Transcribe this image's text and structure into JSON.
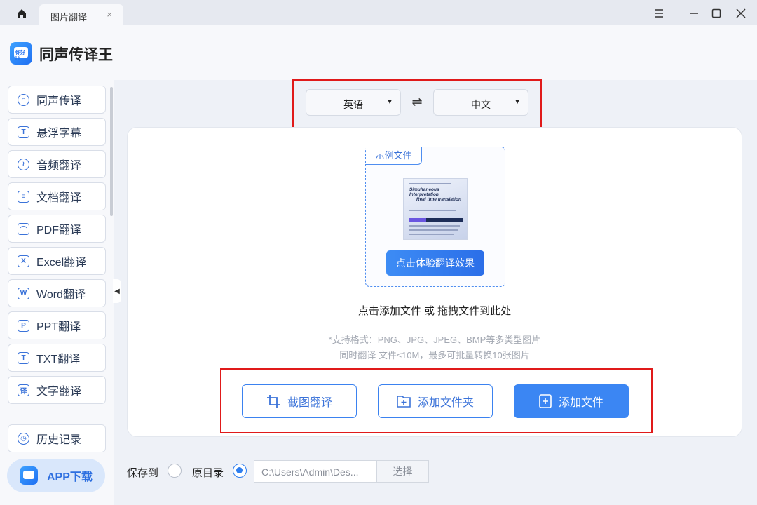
{
  "tab": {
    "label": "图片翻译",
    "close": "×"
  },
  "app": {
    "title": "同声传译王",
    "logo_text": "你好Hi"
  },
  "sidebar": {
    "items": [
      {
        "label": "同声传译",
        "icon": "headset-icon"
      },
      {
        "label": "悬浮字幕",
        "icon": "text-box-icon"
      },
      {
        "label": "音频翻译",
        "icon": "audio-icon"
      },
      {
        "label": "文档翻译",
        "icon": "document-icon"
      },
      {
        "label": "PDF翻译",
        "icon": "pdf-icon"
      },
      {
        "label": "Excel翻译",
        "icon": "excel-icon"
      },
      {
        "label": "Word翻译",
        "icon": "word-icon"
      },
      {
        "label": "PPT翻译",
        "icon": "ppt-icon"
      },
      {
        "label": "TXT翻译",
        "icon": "txt-icon"
      },
      {
        "label": "文字翻译",
        "icon": "translate-icon"
      }
    ],
    "history": "历史记录",
    "app_download": "APP下载"
  },
  "lang": {
    "source": "英语",
    "target": "中文",
    "swap": "⇌"
  },
  "sample": {
    "tag": "示例文件",
    "thumb_line1": "Simultaneous Interpretation",
    "thumb_line2": "Real time translation",
    "try_label": "点击体验翻译效果"
  },
  "drop_hint": "点击添加文件 或 拖拽文件到此处",
  "format_note": {
    "line1": "*支持格式：PNG、JPG、JPEG、BMP等多类型图片",
    "line2": "同时翻译 文件≤10M，最多可批量转换10张图片"
  },
  "actions": {
    "screenshot": "截图翻译",
    "add_folder": "添加文件夹",
    "add_file": "添加文件"
  },
  "save": {
    "label": "保存到",
    "original_dir": "原目录",
    "path": "C:\\Users\\Admin\\Des...",
    "choose": "选择"
  },
  "colors": {
    "accent": "#3b86f3",
    "highlight_border": "#e01a1a"
  }
}
